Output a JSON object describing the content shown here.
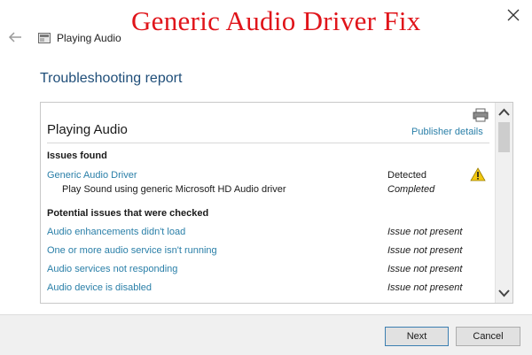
{
  "overlay": {
    "title": "Generic Audio Driver Fix"
  },
  "window": {
    "title": "Playing Audio"
  },
  "page": {
    "title": "Troubleshooting report"
  },
  "report": {
    "name": "Playing Audio",
    "publisher_link": "Publisher details",
    "issues_found_heading": "Issues found",
    "issues_found": [
      {
        "label": "Generic Audio Driver",
        "status": "Detected",
        "icon": "warning-icon"
      },
      {
        "label": "Play Sound using generic Microsoft HD Audio driver",
        "status": "Completed"
      }
    ],
    "checked_heading": "Potential issues that were checked",
    "checked": [
      {
        "label": "Audio enhancements didn't load",
        "status": "Issue not present"
      },
      {
        "label": "One or more audio service isn't running",
        "status": "Issue not present"
      },
      {
        "label": "Audio services not responding",
        "status": "Issue not present"
      },
      {
        "label": "Audio device is disabled",
        "status": "Issue not present"
      }
    ]
  },
  "buttons": {
    "next": "Next",
    "cancel": "Cancel"
  },
  "colors": {
    "overlay_title": "#e0141a",
    "link": "#2a7fa8",
    "heading": "#1f4e79",
    "footer": "#f0f0f0"
  }
}
